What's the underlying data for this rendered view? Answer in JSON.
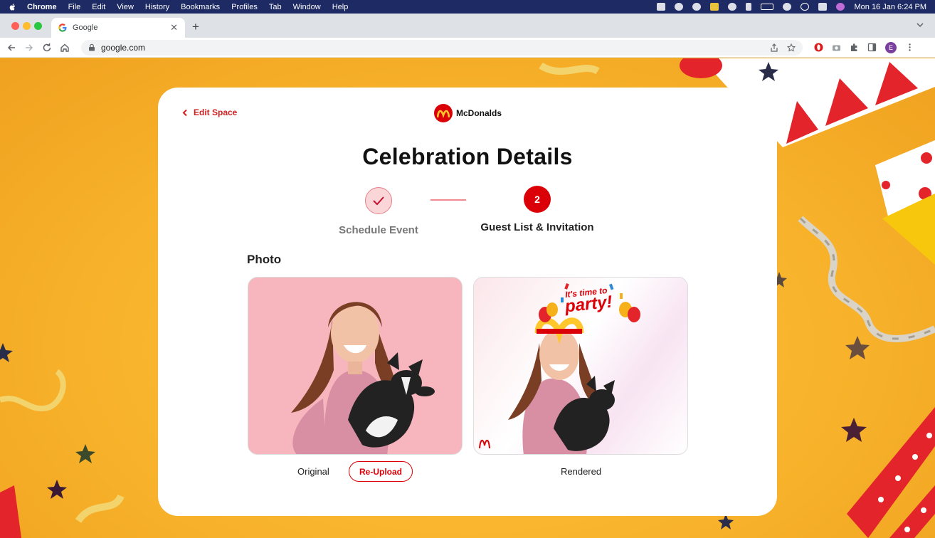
{
  "menubar": {
    "app_name": "Chrome",
    "items": [
      "File",
      "Edit",
      "View",
      "History",
      "Bookmarks",
      "Profiles",
      "Tab",
      "Window",
      "Help"
    ],
    "clock": "Mon 16 Jan  6:24 PM"
  },
  "browser": {
    "tab_title": "Google",
    "url": "google.com",
    "profile_initial": "E"
  },
  "page": {
    "back_label": "Edit Space",
    "brand_name": "McDonalds",
    "title": "Celebration Details",
    "steps": [
      {
        "label": "Schedule Event",
        "state": "done"
      },
      {
        "label": "Guest List & Invitation",
        "number": "2",
        "state": "active"
      }
    ],
    "photo_section_label": "Photo",
    "original_caption": "Original",
    "reupload_label": "Re-Upload",
    "rendered_caption": "Rendered",
    "overlay_text_top": "It's time to",
    "overlay_text_main": "party!"
  },
  "colors": {
    "brand_red": "#db0007",
    "background_yellow": "#f5b427",
    "menubar": "#1d2a63"
  }
}
